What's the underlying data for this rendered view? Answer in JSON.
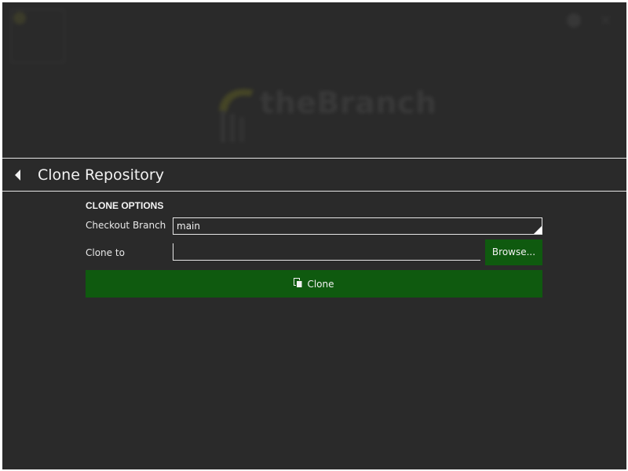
{
  "background": {
    "logo_text": "theBranch"
  },
  "header": {
    "back_icon": "back-arrow-icon",
    "title": "Clone Repository"
  },
  "form": {
    "section_title": "CLONE OPTIONS",
    "checkout_branch": {
      "label": "Checkout Branch",
      "value": "main"
    },
    "clone_to": {
      "label": "Clone to",
      "value": ""
    },
    "browse_label": "Browse...",
    "clone_label": "Clone",
    "clone_icon": "copy-icon"
  },
  "colors": {
    "background": "#2a2a2a",
    "accent_green": "#0f5a0f",
    "border": "#e6e6e6",
    "text": "#f2f2f2"
  }
}
